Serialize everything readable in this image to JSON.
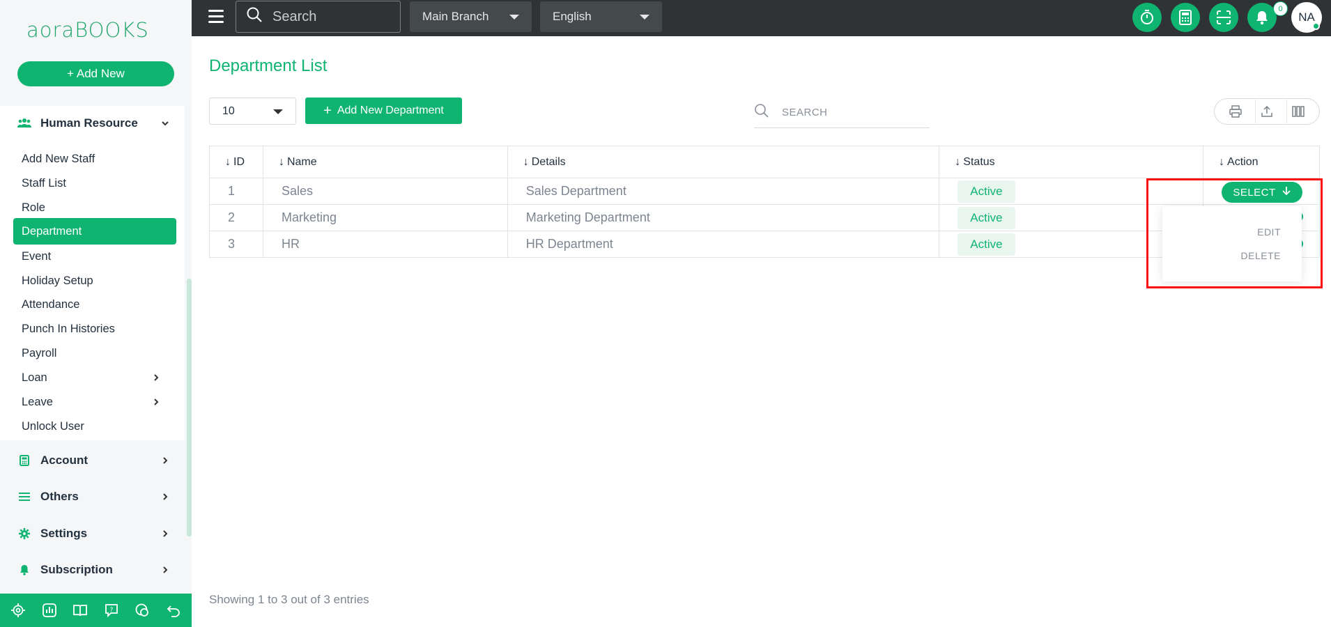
{
  "app": {
    "logo_text": "aoraBOOKS",
    "add_new_label": "+ Add New"
  },
  "sidebar": {
    "sections": [
      {
        "label": "Human Resource",
        "icon": "users-icon",
        "expanded": true
      },
      {
        "label": "Account",
        "icon": "calculator-icon"
      },
      {
        "label": "Others",
        "icon": "list-icon"
      },
      {
        "label": "Settings",
        "icon": "gear-icon"
      },
      {
        "label": "Subscription",
        "icon": "bell-icon"
      }
    ],
    "hr_items": [
      {
        "label": "Add New Staff"
      },
      {
        "label": "Staff List"
      },
      {
        "label": "Role"
      },
      {
        "label": "Department",
        "active": true
      },
      {
        "label": "Event"
      },
      {
        "label": "Holiday Setup"
      },
      {
        "label": "Attendance"
      },
      {
        "label": "Punch In Histories"
      },
      {
        "label": "Payroll"
      },
      {
        "label": "Loan",
        "has_children": true
      },
      {
        "label": "Leave",
        "has_children": true
      },
      {
        "label": "Unlock User"
      }
    ],
    "footer_icons": [
      "gear-icon",
      "chart-icon",
      "book-icon",
      "help-icon",
      "chat-icon",
      "undo-icon"
    ]
  },
  "topbar": {
    "search_placeholder": "Search",
    "branch": "Main Branch",
    "language": "English",
    "notification_count": "0",
    "avatar_initials": "NA"
  },
  "page": {
    "title": "Department List",
    "per_page": "10",
    "add_button": "Add New Department",
    "search_placeholder": "SEARCH",
    "footer": "Showing 1 to 3 out of 3 entries"
  },
  "table": {
    "headers": [
      "ID",
      "Name",
      "Details",
      "Status",
      "Action"
    ],
    "rows": [
      {
        "id": "1",
        "name": "Sales",
        "details": "Sales Department",
        "status": "Active"
      },
      {
        "id": "2",
        "name": "Marketing",
        "details": "Marketing Department",
        "status": "Active"
      },
      {
        "id": "3",
        "name": "HR",
        "details": "HR Department",
        "status": "Active"
      }
    ],
    "action_label": "SELECT",
    "action_menu": [
      "EDIT",
      "DELETE"
    ]
  },
  "colors": {
    "brand": "#0fb471",
    "topbar": "#2f3335",
    "highlight": "#ff1010"
  }
}
